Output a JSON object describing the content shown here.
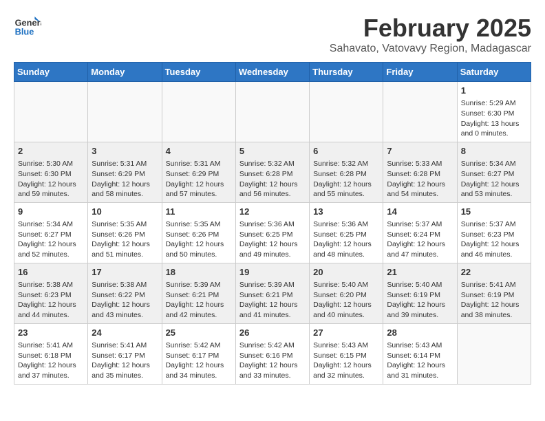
{
  "header": {
    "logo_line1": "General",
    "logo_line2": "Blue",
    "month": "February 2025",
    "location": "Sahavato, Vatovavy Region, Madagascar"
  },
  "weekdays": [
    "Sunday",
    "Monday",
    "Tuesday",
    "Wednesday",
    "Thursday",
    "Friday",
    "Saturday"
  ],
  "weeks": [
    {
      "shaded": false,
      "days": [
        {
          "num": "",
          "info": ""
        },
        {
          "num": "",
          "info": ""
        },
        {
          "num": "",
          "info": ""
        },
        {
          "num": "",
          "info": ""
        },
        {
          "num": "",
          "info": ""
        },
        {
          "num": "",
          "info": ""
        },
        {
          "num": "1",
          "info": "Sunrise: 5:29 AM\nSunset: 6:30 PM\nDaylight: 13 hours\nand 0 minutes."
        }
      ]
    },
    {
      "shaded": true,
      "days": [
        {
          "num": "2",
          "info": "Sunrise: 5:30 AM\nSunset: 6:30 PM\nDaylight: 12 hours\nand 59 minutes."
        },
        {
          "num": "3",
          "info": "Sunrise: 5:31 AM\nSunset: 6:29 PM\nDaylight: 12 hours\nand 58 minutes."
        },
        {
          "num": "4",
          "info": "Sunrise: 5:31 AM\nSunset: 6:29 PM\nDaylight: 12 hours\nand 57 minutes."
        },
        {
          "num": "5",
          "info": "Sunrise: 5:32 AM\nSunset: 6:28 PM\nDaylight: 12 hours\nand 56 minutes."
        },
        {
          "num": "6",
          "info": "Sunrise: 5:32 AM\nSunset: 6:28 PM\nDaylight: 12 hours\nand 55 minutes."
        },
        {
          "num": "7",
          "info": "Sunrise: 5:33 AM\nSunset: 6:28 PM\nDaylight: 12 hours\nand 54 minutes."
        },
        {
          "num": "8",
          "info": "Sunrise: 5:34 AM\nSunset: 6:27 PM\nDaylight: 12 hours\nand 53 minutes."
        }
      ]
    },
    {
      "shaded": false,
      "days": [
        {
          "num": "9",
          "info": "Sunrise: 5:34 AM\nSunset: 6:27 PM\nDaylight: 12 hours\nand 52 minutes."
        },
        {
          "num": "10",
          "info": "Sunrise: 5:35 AM\nSunset: 6:26 PM\nDaylight: 12 hours\nand 51 minutes."
        },
        {
          "num": "11",
          "info": "Sunrise: 5:35 AM\nSunset: 6:26 PM\nDaylight: 12 hours\nand 50 minutes."
        },
        {
          "num": "12",
          "info": "Sunrise: 5:36 AM\nSunset: 6:25 PM\nDaylight: 12 hours\nand 49 minutes."
        },
        {
          "num": "13",
          "info": "Sunrise: 5:36 AM\nSunset: 6:25 PM\nDaylight: 12 hours\nand 48 minutes."
        },
        {
          "num": "14",
          "info": "Sunrise: 5:37 AM\nSunset: 6:24 PM\nDaylight: 12 hours\nand 47 minutes."
        },
        {
          "num": "15",
          "info": "Sunrise: 5:37 AM\nSunset: 6:23 PM\nDaylight: 12 hours\nand 46 minutes."
        }
      ]
    },
    {
      "shaded": true,
      "days": [
        {
          "num": "16",
          "info": "Sunrise: 5:38 AM\nSunset: 6:23 PM\nDaylight: 12 hours\nand 44 minutes."
        },
        {
          "num": "17",
          "info": "Sunrise: 5:38 AM\nSunset: 6:22 PM\nDaylight: 12 hours\nand 43 minutes."
        },
        {
          "num": "18",
          "info": "Sunrise: 5:39 AM\nSunset: 6:21 PM\nDaylight: 12 hours\nand 42 minutes."
        },
        {
          "num": "19",
          "info": "Sunrise: 5:39 AM\nSunset: 6:21 PM\nDaylight: 12 hours\nand 41 minutes."
        },
        {
          "num": "20",
          "info": "Sunrise: 5:40 AM\nSunset: 6:20 PM\nDaylight: 12 hours\nand 40 minutes."
        },
        {
          "num": "21",
          "info": "Sunrise: 5:40 AM\nSunset: 6:19 PM\nDaylight: 12 hours\nand 39 minutes."
        },
        {
          "num": "22",
          "info": "Sunrise: 5:41 AM\nSunset: 6:19 PM\nDaylight: 12 hours\nand 38 minutes."
        }
      ]
    },
    {
      "shaded": false,
      "days": [
        {
          "num": "23",
          "info": "Sunrise: 5:41 AM\nSunset: 6:18 PM\nDaylight: 12 hours\nand 37 minutes."
        },
        {
          "num": "24",
          "info": "Sunrise: 5:41 AM\nSunset: 6:17 PM\nDaylight: 12 hours\nand 35 minutes."
        },
        {
          "num": "25",
          "info": "Sunrise: 5:42 AM\nSunset: 6:17 PM\nDaylight: 12 hours\nand 34 minutes."
        },
        {
          "num": "26",
          "info": "Sunrise: 5:42 AM\nSunset: 6:16 PM\nDaylight: 12 hours\nand 33 minutes."
        },
        {
          "num": "27",
          "info": "Sunrise: 5:43 AM\nSunset: 6:15 PM\nDaylight: 12 hours\nand 32 minutes."
        },
        {
          "num": "28",
          "info": "Sunrise: 5:43 AM\nSunset: 6:14 PM\nDaylight: 12 hours\nand 31 minutes."
        },
        {
          "num": "",
          "info": ""
        }
      ]
    }
  ]
}
